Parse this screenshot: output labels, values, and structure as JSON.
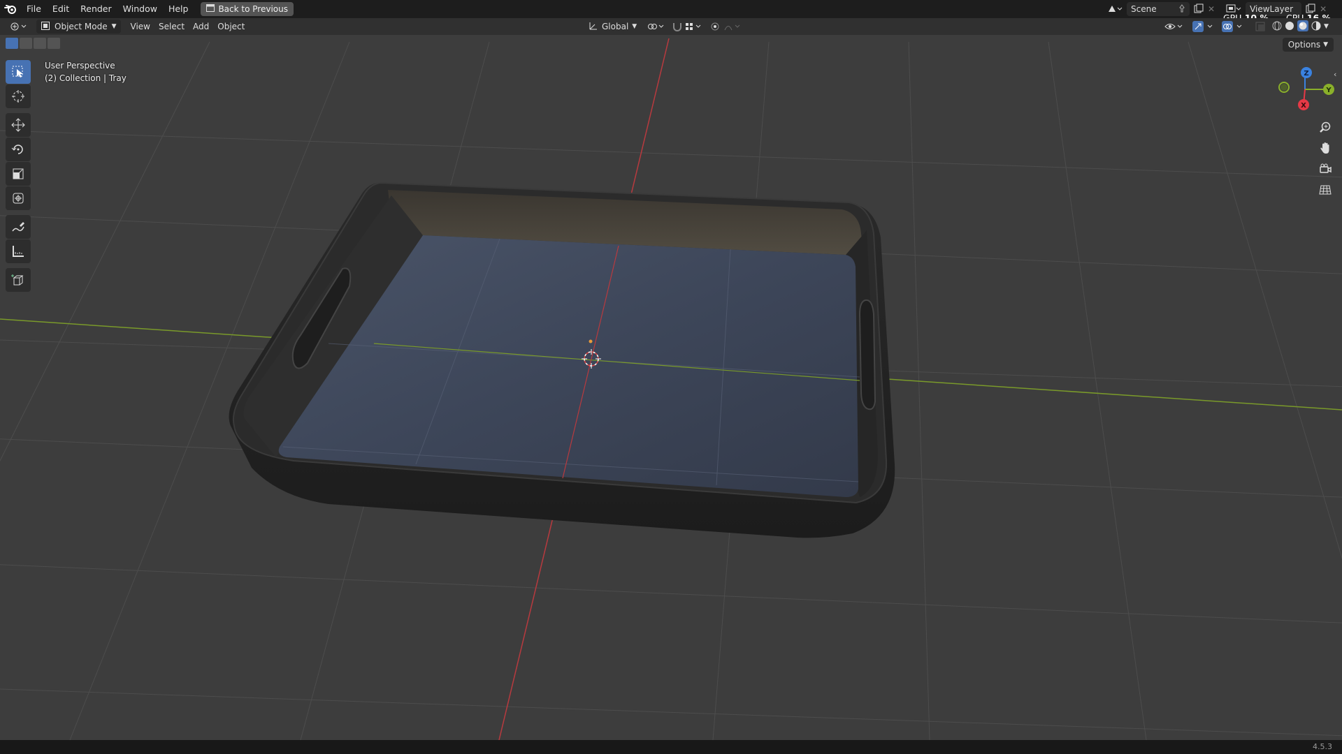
{
  "menu": {
    "items": [
      "File",
      "Edit",
      "Render",
      "Window",
      "Help"
    ],
    "back_button": "Back to Previous"
  },
  "scene": {
    "name": "Scene",
    "view_layer": "ViewLayer"
  },
  "stats": {
    "gpu_label": "GPU",
    "gpu_value": "10 %",
    "cpu_label": "CPU",
    "cpu_value": "16 %"
  },
  "header": {
    "mode": "Object Mode",
    "menus": [
      "View",
      "Select",
      "Add",
      "Object"
    ],
    "transform_orientation": "Global",
    "options": "Options"
  },
  "viewport": {
    "perspective_label": "User Perspective",
    "collection_label": "(2) Collection | Tray"
  },
  "gizmo": {
    "x": "X",
    "y": "Y",
    "z": "Z"
  },
  "status": {
    "version": "4.5.3"
  },
  "colors": {
    "accent": "#4772b3",
    "x_axis": "#e63946",
    "y_axis": "#8ab02a",
    "z_axis": "#3a82e0"
  }
}
